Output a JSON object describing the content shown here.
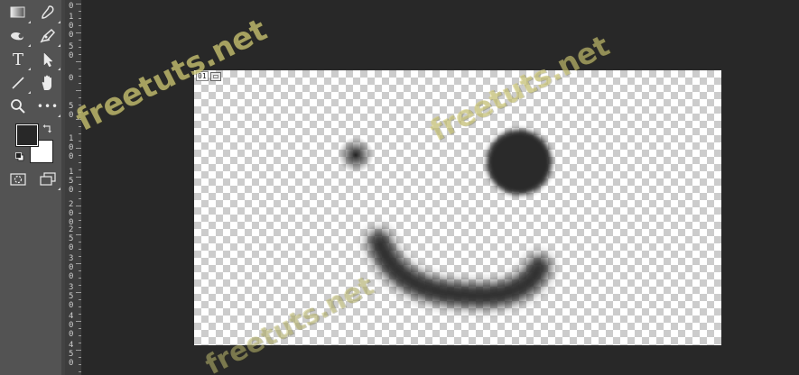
{
  "toolbar": {
    "tools": [
      {
        "name": "gradient-tool",
        "icon": "gradient-icon"
      },
      {
        "name": "eyedropper-brush-tool",
        "icon": "smudge-brush-icon"
      },
      {
        "name": "dodge-tool",
        "icon": "dodge-icon"
      },
      {
        "name": "pen-tool",
        "icon": "pen-icon"
      },
      {
        "name": "type-tool",
        "icon": "type-icon"
      },
      {
        "name": "path-selection-tool",
        "icon": "arrow-cursor-icon"
      },
      {
        "name": "line-tool",
        "icon": "line-icon"
      },
      {
        "name": "hand-tool",
        "icon": "hand-icon"
      },
      {
        "name": "zoom-tool",
        "icon": "zoom-icon"
      },
      {
        "name": "more-tools",
        "icon": "more-dots-icon"
      }
    ],
    "type_tool_glyph": "T",
    "more_tools_glyph": "•••",
    "foreground_color": "#282828",
    "background_color": "#ffffff"
  },
  "ruler": {
    "labels": [
      {
        "text": "0"
      },
      {
        "text": "100"
      },
      {
        "text": "50"
      },
      {
        "text": "0"
      },
      {
        "text": "50"
      },
      {
        "text": "100"
      },
      {
        "text": "150"
      },
      {
        "text": "200"
      },
      {
        "text": "250"
      },
      {
        "text": "300"
      },
      {
        "text": "350"
      },
      {
        "text": "400"
      },
      {
        "text": "450"
      }
    ]
  },
  "document": {
    "layer_number": "01",
    "transparency_grid": true,
    "content": "smiley-face-brush-strokes"
  },
  "watermarks": [
    "freetuts.net",
    "freetuts.net",
    "freetuts.net"
  ],
  "colors": {
    "app_background": "#282828",
    "panel": "#535353",
    "ruler": "#3d3d3d",
    "watermark": "#d6ce78",
    "stroke": "#2a2a2a"
  }
}
